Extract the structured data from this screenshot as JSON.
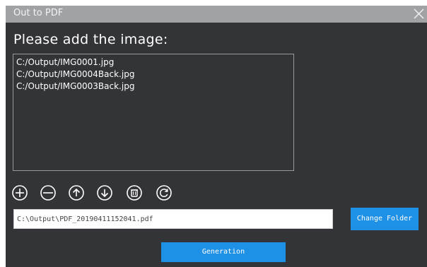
{
  "dialog": {
    "title": "Out to PDF",
    "close_icon": "close-x",
    "heading": "Please add the image:"
  },
  "file_list": {
    "items": [
      "C:/Output/IMG0001.jpg",
      "C:/Output/IMG0004Back.jpg",
      "C:/Output/IMG0003Back.jpg"
    ]
  },
  "toolbar": {
    "icons": [
      "add-circle-icon",
      "remove-circle-icon",
      "move-up-icon",
      "move-down-icon",
      "delete-trash-icon",
      "refresh-icon"
    ]
  },
  "output": {
    "path_value": "C:\\Output\\PDF_20190411152041.pdf",
    "change_folder_label": "Change Folder"
  },
  "actions": {
    "generation_label": "Generation"
  },
  "colors": {
    "dialog_bg": "#333437",
    "titlebar_bg": "#a1a2a5",
    "accent": "#1e90e6"
  }
}
